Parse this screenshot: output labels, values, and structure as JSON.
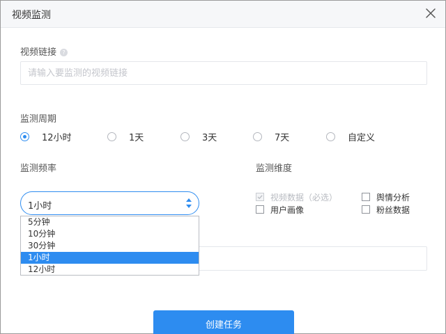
{
  "dialog": {
    "title": "视频监测"
  },
  "video_link": {
    "label": "视频链接",
    "help": "?",
    "placeholder": "请输入要监测的视频链接",
    "value": ""
  },
  "period": {
    "label": "监测周期",
    "options": [
      "12小时",
      "1天",
      "3天",
      "7天",
      "自定义"
    ],
    "selected": "12小时"
  },
  "frequency": {
    "label": "监测频率",
    "selected": "1小时",
    "options": [
      "5分钟",
      "10分钟",
      "30分钟",
      "1小时",
      "12小时"
    ]
  },
  "dimensions": {
    "label": "监测维度",
    "items": [
      {
        "label": "视频数据（必选）",
        "checked": true,
        "disabled": true
      },
      {
        "label": "舆情分析",
        "checked": false,
        "disabled": false
      },
      {
        "label": "用户画像",
        "checked": false,
        "disabled": false
      },
      {
        "label": "粉丝数据",
        "checked": false,
        "disabled": false
      }
    ]
  },
  "actions": {
    "submit_label": "创建任务"
  },
  "colors": {
    "accent": "#2d8cf0",
    "header_bg": "#f6f7f9"
  },
  "icons": {
    "close": "close-icon",
    "select_arrows": "sort-arrows-icon",
    "help": "help-icon",
    "check": "check-icon"
  }
}
